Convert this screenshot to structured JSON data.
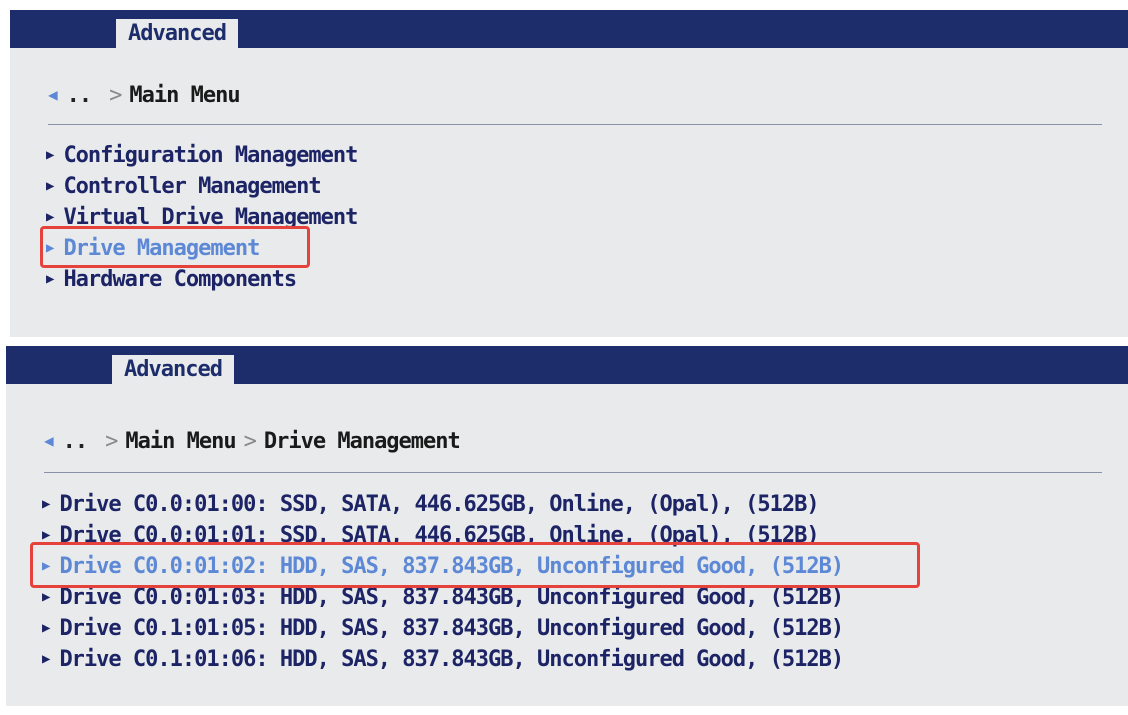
{
  "panel1": {
    "tab_label": "Advanced",
    "breadcrumb": {
      "back": "..",
      "items": [
        "Main Menu"
      ]
    },
    "menu": [
      {
        "label": "Configuration Management"
      },
      {
        "label": "Controller Management"
      },
      {
        "label": "Virtual Drive Management"
      },
      {
        "label": "Drive Management",
        "selected": true
      },
      {
        "label": "Hardware Components"
      }
    ]
  },
  "panel2": {
    "tab_label": "Advanced",
    "breadcrumb": {
      "back": "..",
      "items": [
        "Main Menu",
        "Drive Management"
      ]
    },
    "drives": [
      {
        "label": "Drive C0.0:01:00: SSD, SATA, 446.625GB, Online, (Opal), (512B)"
      },
      {
        "label": "Drive C0.0:01:01: SSD, SATA, 446.625GB, Online, (Opal), (512B)"
      },
      {
        "label": "Drive C0.0:01:02: HDD, SAS, 837.843GB, Unconfigured Good, (512B)",
        "selected": true
      },
      {
        "label": "Drive C0.0:01:03: HDD, SAS, 837.843GB, Unconfigured Good, (512B)"
      },
      {
        "label": "Drive C0.1:01:05: HDD, SAS, 837.843GB, Unconfigured Good, (512B)"
      },
      {
        "label": "Drive C0.1:01:06: HDD, SAS, 837.843GB, Unconfigured Good, (512B)"
      }
    ]
  },
  "colors": {
    "header_bar": "#1d2d6b",
    "panel_bg": "#e8eaec",
    "menu_text": "#1d2466",
    "selected_text": "#5d88d6",
    "highlight_box": "#e5423b"
  }
}
